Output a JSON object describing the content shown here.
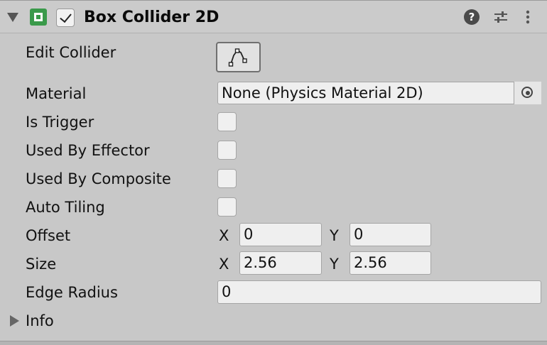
{
  "component": {
    "title": "Box Collider 2D",
    "enabled": true,
    "icons": {
      "fold": "triangle-down-icon",
      "component": "box-collider-icon",
      "help": "help-icon",
      "presets": "presets-icon",
      "menu": "kebab-menu-icon"
    },
    "help_glyph": "?"
  },
  "fields": {
    "edit_collider": {
      "label": "Edit Collider",
      "icon": "edit-collider-icon"
    },
    "material": {
      "label": "Material",
      "value": "None (Physics Material 2D)",
      "picker_icon": "object-picker-icon"
    },
    "is_trigger": {
      "label": "Is Trigger",
      "checked": false
    },
    "used_by_effector": {
      "label": "Used By Effector",
      "checked": false
    },
    "used_by_composite": {
      "label": "Used By Composite",
      "checked": false
    },
    "auto_tiling": {
      "label": "Auto Tiling",
      "checked": false
    },
    "offset": {
      "label": "Offset",
      "x_label": "X",
      "x": "0",
      "y_label": "Y",
      "y": "0"
    },
    "size": {
      "label": "Size",
      "x_label": "X",
      "x": "2.56",
      "y_label": "Y",
      "y": "2.56"
    },
    "edge_radius": {
      "label": "Edge Radius",
      "value": "0"
    },
    "info": {
      "label": "Info",
      "expanded": false
    }
  }
}
